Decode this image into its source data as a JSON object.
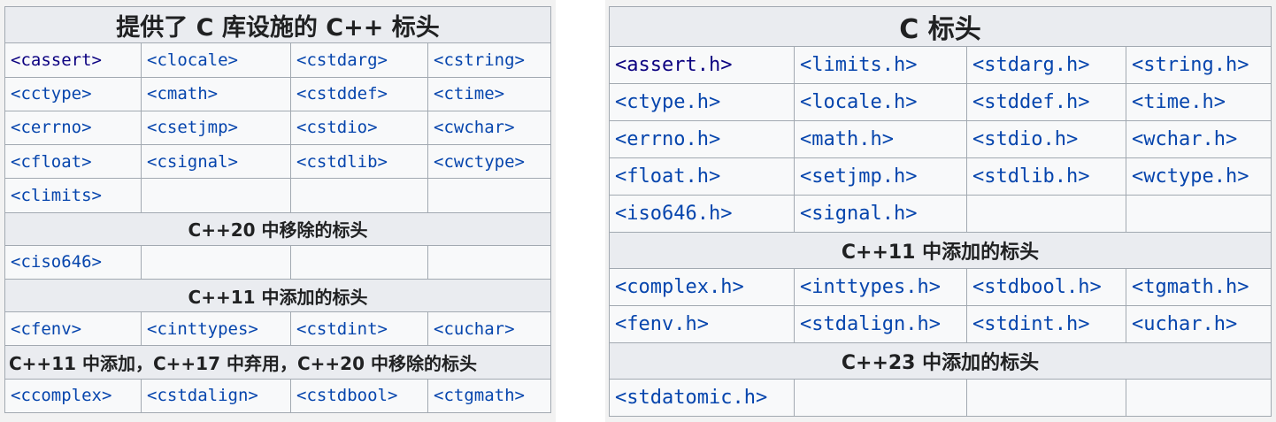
{
  "left_table": {
    "title": "提供了 C 库设施的 C++ 标头",
    "main_rows": [
      [
        "<cassert>",
        "<clocale>",
        "<cstdarg>",
        "<cstring>"
      ],
      [
        "<cctype>",
        "<cmath>",
        "<cstddef>",
        "<ctime>"
      ],
      [
        "<cerrno>",
        "<csetjmp>",
        "<cstdio>",
        "<cwchar>"
      ],
      [
        "<cfloat>",
        "<csignal>",
        "<cstdlib>",
        "<cwctype>"
      ],
      [
        "<climits>",
        "",
        "",
        ""
      ]
    ],
    "removed_cpp20": {
      "heading": "C++20 中移除的标头",
      "row": [
        "<ciso646>",
        "",
        "",
        ""
      ]
    },
    "added_cpp11": {
      "heading": "C++11 中添加的标头",
      "row": [
        "<cfenv>",
        "<cinttypes>",
        "<cstdint>",
        "<cuchar>"
      ]
    },
    "deprecated": {
      "heading": "C++11 中添加，C++17 中弃用，C++20 中移除的标头",
      "row": [
        "<ccomplex>",
        "<cstdalign>",
        "<cstdbool>",
        "<ctgmath>"
      ]
    }
  },
  "right_table": {
    "title": "C 标头",
    "main_rows": [
      [
        "<assert.h>",
        "<limits.h>",
        "<stdarg.h>",
        "<string.h>"
      ],
      [
        "<ctype.h>",
        "<locale.h>",
        "<stddef.h>",
        "<time.h>"
      ],
      [
        "<errno.h>",
        "<math.h>",
        "<stdio.h>",
        "<wchar.h>"
      ],
      [
        "<float.h>",
        "<setjmp.h>",
        "<stdlib.h>",
        "<wctype.h>"
      ],
      [
        "<iso646.h>",
        "<signal.h>",
        "",
        ""
      ]
    ],
    "added_cpp11": {
      "heading": "C++11 中添加的标头",
      "rows": [
        [
          "<complex.h>",
          "<inttypes.h>",
          "<stdbool.h>",
          "<tgmath.h>"
        ],
        [
          "<fenv.h>",
          "<stdalign.h>",
          "<stdint.h>",
          "<uchar.h>"
        ]
      ]
    },
    "added_cpp23": {
      "heading": "C++23 中添加的标头",
      "row": [
        "<stdatomic.h>",
        "",
        "",
        ""
      ]
    }
  },
  "colors": {
    "link": "#0645ad",
    "visited_link": "#0b0080",
    "header_bg": "#eaecf0",
    "cell_bg": "#f8f9fa",
    "border": "#a2a9b1"
  }
}
